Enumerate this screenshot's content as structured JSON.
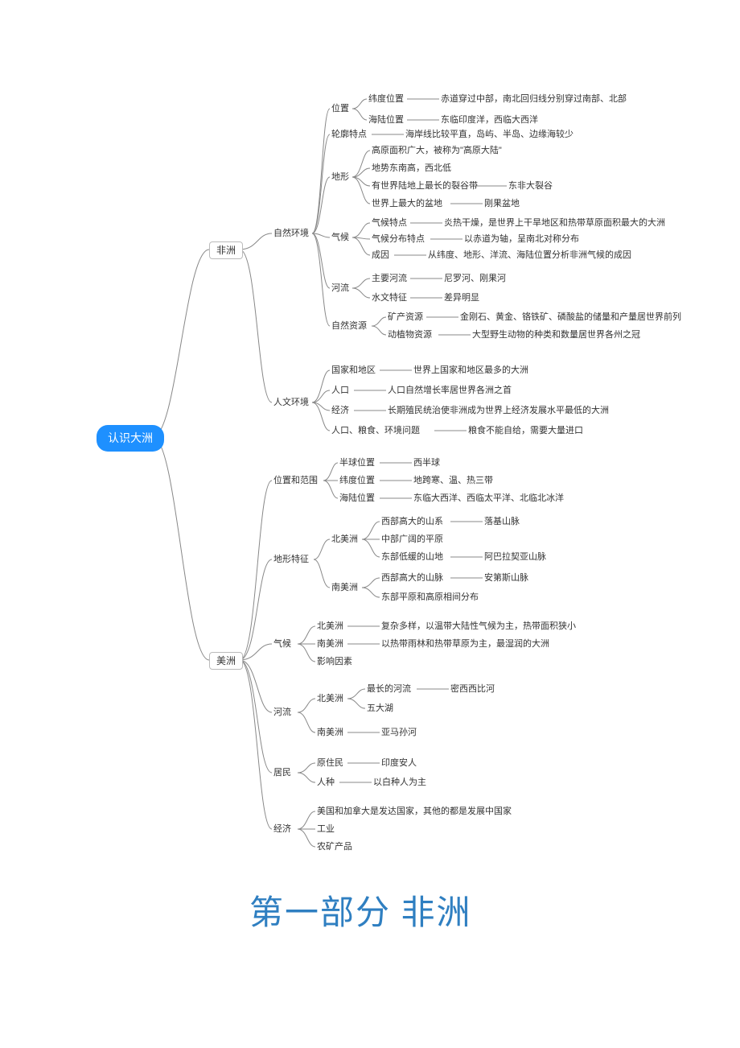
{
  "root": "认识大洲",
  "africa": "非洲",
  "america": "美洲",
  "section_title": "第一部分 非洲",
  "af": {
    "env": "自然环境",
    "pos": "位置",
    "pos_lat": "纬度位置",
    "pos_lat_v": "赤道穿过中部，南北回归线分别穿过南部、北部",
    "pos_sea": "海陆位置",
    "pos_sea_v": "东临印度洋，西临大西洋",
    "outline": "轮廓特点",
    "outline_v": "海岸线比较平直，岛屿、半岛、边缘海较少",
    "terrain": "地形",
    "t1": "高原面积广大，被称为\"高原大陆\"",
    "t2": "地势东南高，西北低",
    "t3": "有世界陆地上最长的裂谷带",
    "t3v": "东非大裂谷",
    "t4": "世界上最大的盆地",
    "t4v": "刚果盆地",
    "climate": "气候",
    "c1": "气候特点",
    "c1v": "炎热干燥，是世界上干旱地区和热带草原面积最大的大洲",
    "c2": "气候分布特点",
    "c2v": "以赤道为轴，呈南北对称分布",
    "c3": "成因",
    "c3v": "从纬度、地形、洋流、海陆位置分析非洲气候的成因",
    "river": "河流",
    "r1": "主要河流",
    "r1v": "尼罗河、刚果河",
    "r2": "水文特征",
    "r2v": "差异明显",
    "res": "自然资源",
    "res1": "矿产资源",
    "res1v": "金刚石、黄金、铬铁矿、磷酸盐的储量和产量居世界前列",
    "res2": "动植物资源",
    "res2v": "大型野生动物的种类和数量居世界各州之冠",
    "human": "人文环境",
    "h1": "国家和地区",
    "h1v": "世界上国家和地区最多的大洲",
    "h2": "人口",
    "h2v": "人口自然增长率居世界各洲之首",
    "h3": "经济",
    "h3v": "长期殖民统治使非洲成为世界上经济发展水平最低的大洲",
    "h4": "人口、粮食、环境问题",
    "h4v": "粮食不能自给，需要大量进口"
  },
  "am": {
    "range": "位置和范围",
    "r1": "半球位置",
    "r1v": "西半球",
    "r2": "纬度位置",
    "r2v": "地跨寒、温、热三带",
    "r3": "海陆位置",
    "r3v": "东临大西洋、西临太平洋、北临北冰洋",
    "terrain": "地形特征",
    "na": "北美洲",
    "na1": "西部高大的山系",
    "na1v": "落基山脉",
    "na2": "中部广阔的平原",
    "na3": "东部低缓的山地",
    "na3v": "阿巴拉契亚山脉",
    "sa": "南美洲",
    "sa1": "西部高大的山脉",
    "sa1v": "安第斯山脉",
    "sa2": "东部平原和高原相间分布",
    "climate": "气候",
    "cl_na": "北美洲",
    "cl_na_v": "复杂多样，以温带大陆性气候为主，热带面积狭小",
    "cl_sa": "南美洲",
    "cl_sa_v": "以热带雨林和热带草原为主，最湿润的大洲",
    "cl_f": "影响因素",
    "river": "河流",
    "rv_na": "北美洲",
    "rv_na1": "最长的河流",
    "rv_na1v": "密西西比河",
    "rv_na2": "五大湖",
    "rv_sa": "南美洲",
    "rv_sa_v": "亚马孙河",
    "people": "居民",
    "p1": "原住民",
    "p1v": "印度安人",
    "p2": "人种",
    "p2v": "以白种人为主",
    "econ": "经济",
    "e1": "美国和加拿大是发达国家，其他的都是发展中国家",
    "e2": "工业",
    "e3": "农矿产品"
  }
}
